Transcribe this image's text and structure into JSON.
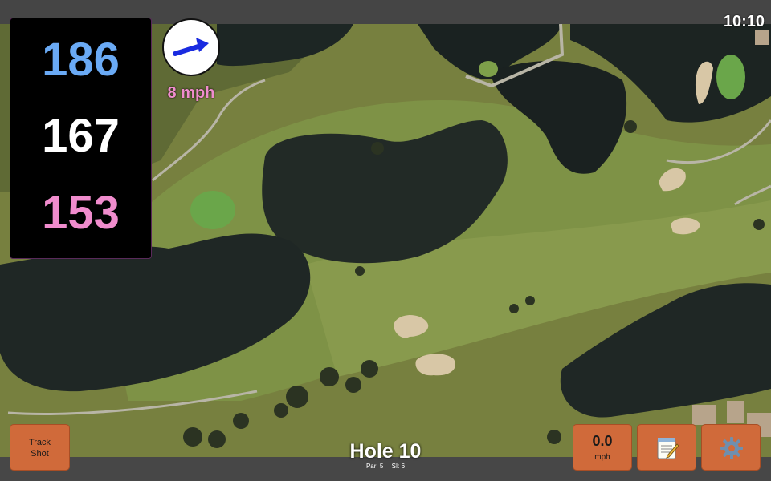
{
  "status": {
    "time": "10:10"
  },
  "distances": {
    "back": "186",
    "middle": "167",
    "front": "153"
  },
  "wind": {
    "speed": "8 mph",
    "icon": "wind-arrow-icon"
  },
  "buttons": {
    "track_shot": {
      "line1": "Track",
      "line2": "Shot"
    },
    "speed": {
      "value": "0.0",
      "unit": "mph"
    },
    "notes_icon": "notepad-icon",
    "settings_icon": "gear-icon"
  },
  "hole": {
    "title": "Hole 10",
    "par_label": "Par:",
    "par": "5",
    "si_label": "SI:",
    "si": "6"
  },
  "colors": {
    "back": "#6aaaf5",
    "middle": "#ffffff",
    "front": "#f08ccd",
    "button": "#d06a3a"
  }
}
